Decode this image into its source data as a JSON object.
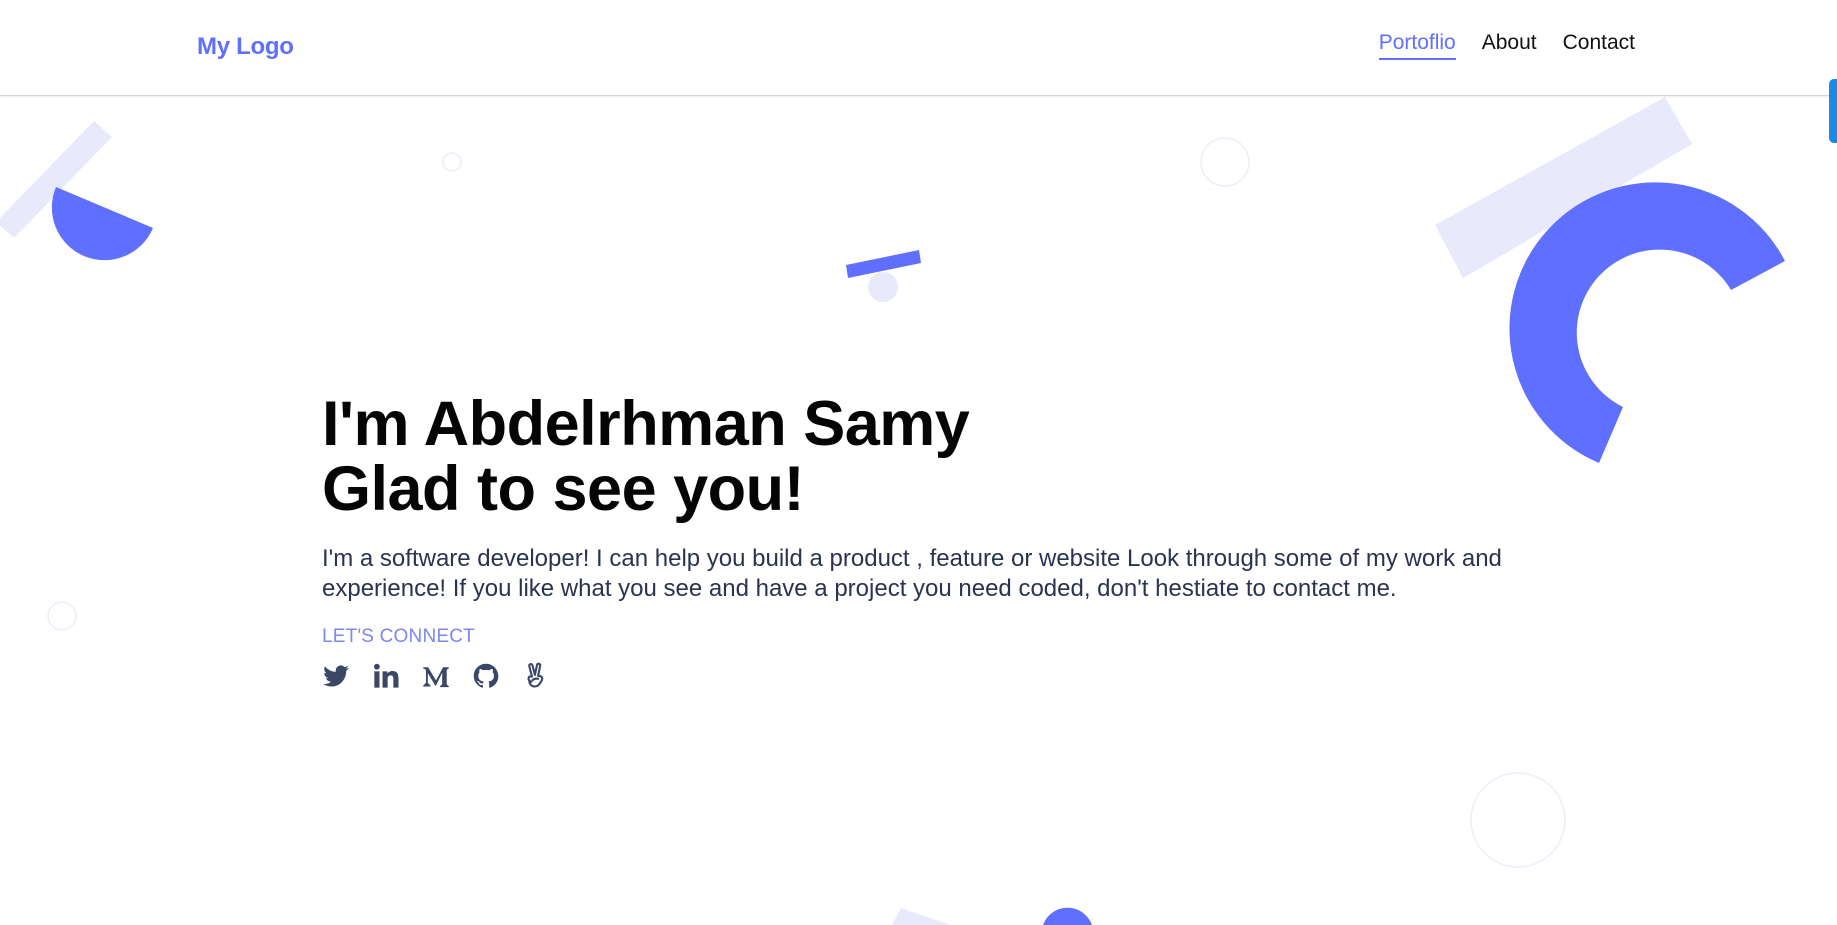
{
  "nav": {
    "logo": "My Logo",
    "links": [
      {
        "label": "Portoflio",
        "active": true
      },
      {
        "label": "About",
        "active": false
      },
      {
        "label": "Contact",
        "active": false
      }
    ]
  },
  "hero": {
    "title_line1": "I'm Abdelrhman Samy",
    "title_line2": "Glad to see you!",
    "description": "I'm a software developer! I can help you build a product , feature or website Look through some of my work and experience! If you like what you see and have a project you need coded, don't hestiate to contact me.",
    "connect_label": "LET'S CONNECT",
    "social_icons": [
      "twitter-icon",
      "linkedin-icon",
      "medium-icon",
      "github-icon",
      "peace-hand-icon"
    ]
  },
  "colors": {
    "accent": "#5f6fff",
    "shape_light": "#e8eafc",
    "text_dark": "#050505",
    "text_body": "#2a3450",
    "icon": "#3a4766",
    "scrollbar": "#1e88e5"
  }
}
